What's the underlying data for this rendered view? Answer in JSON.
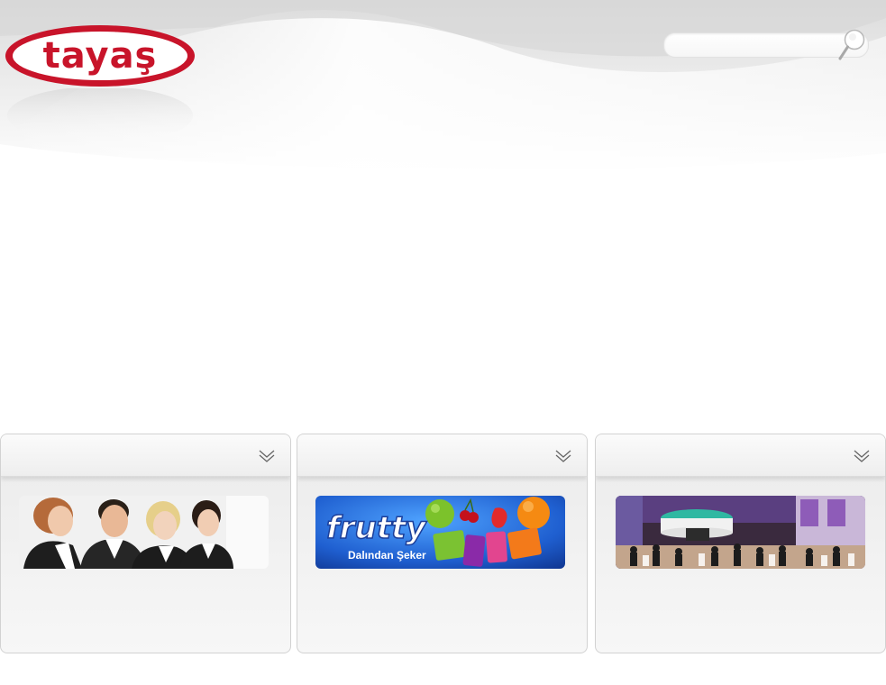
{
  "brand": {
    "logo_text": "tayaş",
    "logo_color": "#c8142a"
  },
  "search": {
    "value": "",
    "placeholder": ""
  },
  "panels": [
    {
      "id": "people",
      "image": "team-photo",
      "caption": ""
    },
    {
      "id": "frutty",
      "image": "frutty-banner",
      "banner_title": "frutty",
      "banner_subtitle": "Dalından Şeker",
      "caption": ""
    },
    {
      "id": "fair",
      "image": "trade-fair-photo",
      "caption": ""
    }
  ],
  "colors": {
    "accent": "#c8142a",
    "frutty_blue": "#1f5fd0",
    "panel_border": "#d2d2d2"
  }
}
